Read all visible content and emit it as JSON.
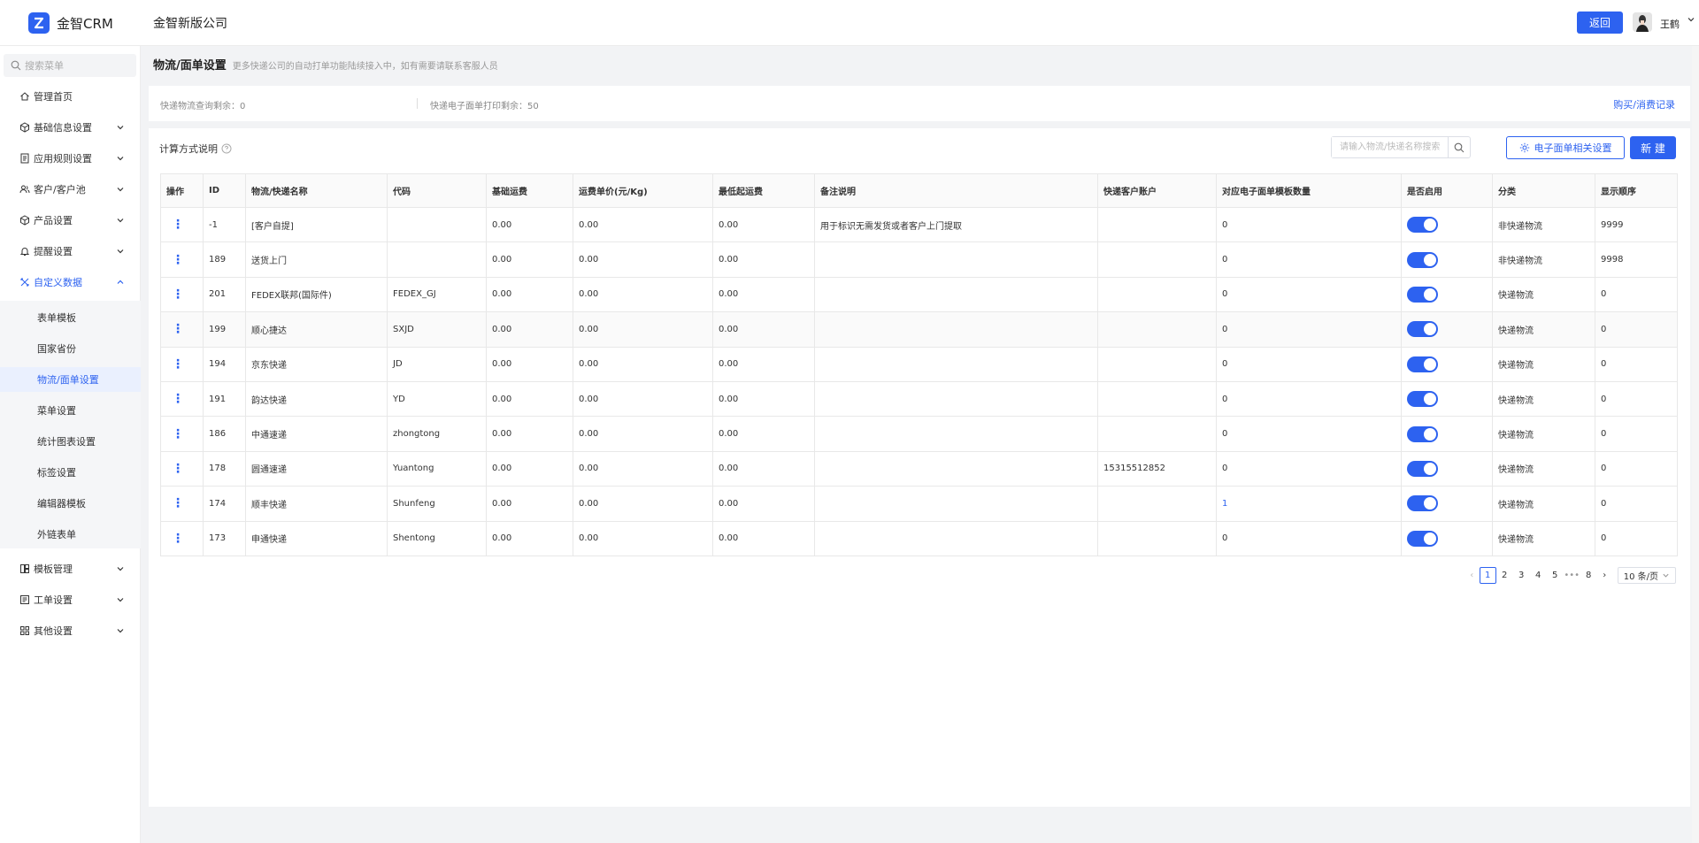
{
  "app": {
    "name": "金智CRM",
    "company": "金智新版公司"
  },
  "header": {
    "back_label": "返回",
    "user_name": "王鹤"
  },
  "sidebar": {
    "search_placeholder": "搜索菜单",
    "items": [
      {
        "label": "管理首页",
        "icon": "home-icon"
      },
      {
        "label": "基础信息设置",
        "icon": "cube-icon"
      },
      {
        "label": "应用规则设置",
        "icon": "document-icon"
      },
      {
        "label": "客户/客户池",
        "icon": "users-icon"
      },
      {
        "label": "产品设置",
        "icon": "box-icon"
      },
      {
        "label": "提醒设置",
        "icon": "bell-icon"
      },
      {
        "label": "自定义数据",
        "icon": "tools-icon"
      }
    ],
    "subitems": [
      "表单模板",
      "国家省份",
      "物流/面单设置",
      "菜单设置",
      "统计图表设置",
      "标签设置",
      "编辑器模板",
      "外链表单"
    ],
    "bottom_items": [
      {
        "label": "模板管理",
        "icon": "template-icon"
      },
      {
        "label": "工单设置",
        "icon": "ticket-icon"
      },
      {
        "label": "其他设置",
        "icon": "grid-icon"
      }
    ]
  },
  "page": {
    "title": "物流/面单设置",
    "subtitle": "更多快递公司的自动打单功能陆续接入中，如有需要请联系客服人员"
  },
  "stats": {
    "query_label": "快递物流查询剩余：",
    "query_value": "0",
    "print_label": "快递电子面单打印剩余：",
    "print_value": "50",
    "buy_link": "购买/消费记录"
  },
  "toolbar": {
    "calc_label": "计算方式说明",
    "search_placeholder": "请输入物流/快递名称搜索",
    "eface_label": "电子面单相关设置",
    "new_label": "新 建"
  },
  "table": {
    "headers": [
      "操作",
      "ID",
      "物流/快递名称",
      "代码",
      "基础运费",
      "运费单价(元/Kg)",
      "最低起运费",
      "备注说明",
      "快递客户账户",
      "对应电子面单模板数量",
      "是否启用",
      "分类",
      "显示顺序"
    ],
    "rows": [
      {
        "id": "-1",
        "name": "[客户自提]",
        "code": "",
        "base": "0.00",
        "unit": "0.00",
        "min": "0.00",
        "remark": "用于标识无需发货或者客户上门提取",
        "account": "",
        "templates": "0",
        "category": "非快递物流",
        "order": "9999"
      },
      {
        "id": "189",
        "name": "送货上门",
        "code": "",
        "base": "0.00",
        "unit": "0.00",
        "min": "0.00",
        "remark": "",
        "account": "",
        "templates": "0",
        "category": "非快递物流",
        "order": "9998"
      },
      {
        "id": "201",
        "name": "FEDEX联邦(国际件)",
        "code": "FEDEX_GJ",
        "base": "0.00",
        "unit": "0.00",
        "min": "0.00",
        "remark": "",
        "account": "",
        "templates": "0",
        "category": "快递物流",
        "order": "0"
      },
      {
        "id": "199",
        "name": "顺心捷达",
        "code": "SXJD",
        "base": "0.00",
        "unit": "0.00",
        "min": "0.00",
        "remark": "",
        "account": "",
        "templates": "0",
        "category": "快递物流",
        "order": "0"
      },
      {
        "id": "194",
        "name": "京东快递",
        "code": "JD",
        "base": "0.00",
        "unit": "0.00",
        "min": "0.00",
        "remark": "",
        "account": "",
        "templates": "0",
        "category": "快递物流",
        "order": "0"
      },
      {
        "id": "191",
        "name": "韵达快递",
        "code": "YD",
        "base": "0.00",
        "unit": "0.00",
        "min": "0.00",
        "remark": "",
        "account": "",
        "templates": "0",
        "category": "快递物流",
        "order": "0"
      },
      {
        "id": "186",
        "name": "中通速递",
        "code": "zhongtong",
        "base": "0.00",
        "unit": "0.00",
        "min": "0.00",
        "remark": "",
        "account": "",
        "templates": "0",
        "category": "快递物流",
        "order": "0"
      },
      {
        "id": "178",
        "name": "圆通速递",
        "code": "Yuantong",
        "base": "0.00",
        "unit": "0.00",
        "min": "0.00",
        "remark": "",
        "account": "15315512852",
        "templates": "0",
        "category": "快递物流",
        "order": "0"
      },
      {
        "id": "174",
        "name": "顺丰快递",
        "code": "Shunfeng",
        "base": "0.00",
        "unit": "0.00",
        "min": "0.00",
        "remark": "",
        "account": "",
        "templates": "1",
        "category": "快递物流",
        "order": "0"
      },
      {
        "id": "173",
        "name": "申通快递",
        "code": "Shentong",
        "base": "0.00",
        "unit": "0.00",
        "min": "0.00",
        "remark": "",
        "account": "",
        "templates": "0",
        "category": "快递物流",
        "order": "0"
      }
    ]
  },
  "pagination": {
    "pages": [
      "1",
      "2",
      "3",
      "4",
      "5"
    ],
    "ellipsis": "•••",
    "last_page": "8",
    "page_size": "10 条/页",
    "current": "1"
  },
  "colors": {
    "accent": "#2d62f0"
  }
}
